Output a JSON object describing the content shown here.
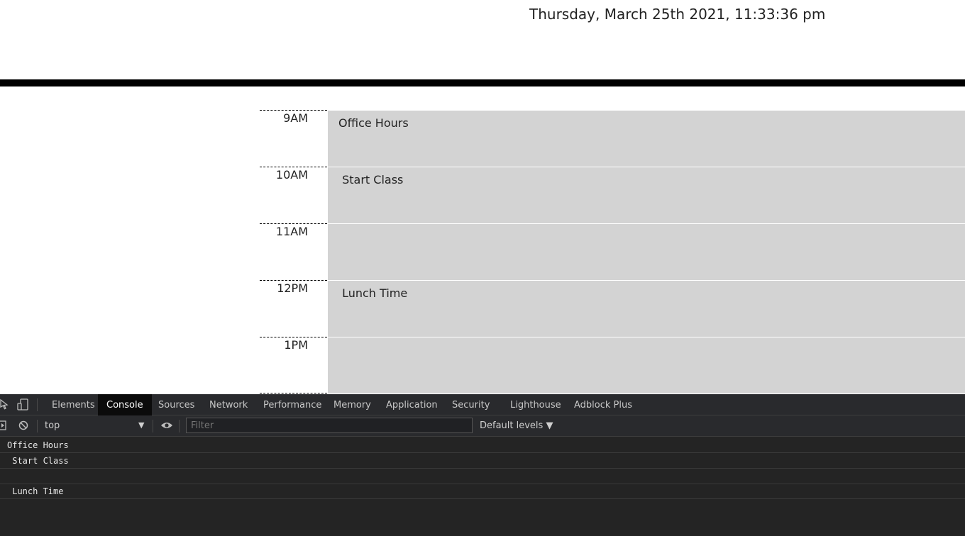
{
  "header": {
    "date": "Thursday, March 25th 2021, 11:33:36 pm"
  },
  "schedule": {
    "rows": [
      {
        "hour": "9AM",
        "text": "Office Hours"
      },
      {
        "hour": "10AM",
        "text": " Start Class"
      },
      {
        "hour": "11AM",
        "text": ""
      },
      {
        "hour": "12PM",
        "text": " Lunch Time"
      },
      {
        "hour": "1PM",
        "text": ""
      }
    ]
  },
  "devtools": {
    "tabs": [
      "Elements",
      "Console",
      "Sources",
      "Network",
      "Performance",
      "Memory",
      "Application",
      "Security",
      "Lighthouse",
      "Adblock Plus"
    ],
    "active_tab": "Console",
    "context": "top",
    "filter_placeholder": "Filter",
    "levels": "Default levels ▼",
    "console_lines": [
      "Office Hours",
      " Start Class",
      "",
      " Lunch Time"
    ]
  }
}
